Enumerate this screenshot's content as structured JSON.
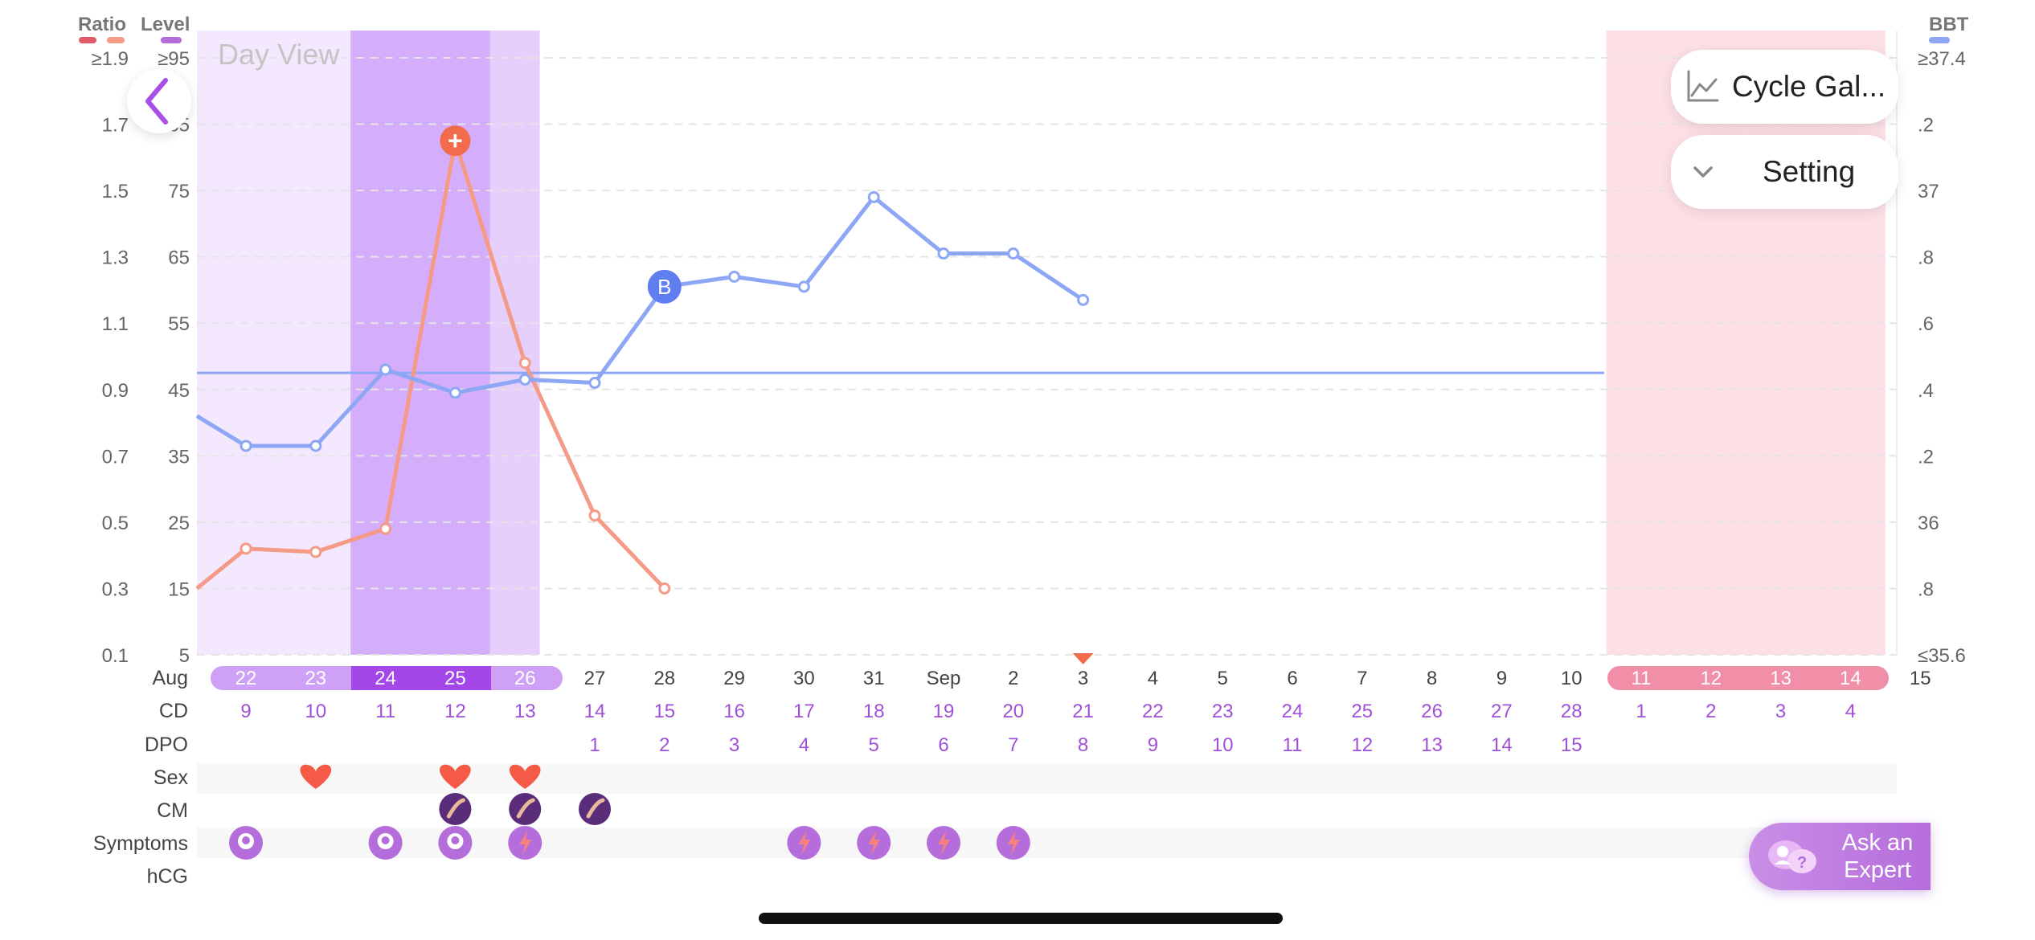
{
  "view_label": "Day View",
  "header": {
    "ratio_label": "Ratio",
    "level_label": "Level",
    "bbt_label": "BBT"
  },
  "axes": {
    "ratio_ticks": [
      "≥1.9",
      "1.7",
      "1.5",
      "1.3",
      "1.1",
      "0.9",
      "0.7",
      "0.5",
      "0.3",
      "0.1"
    ],
    "level_ticks": [
      "≥95",
      "85",
      "75",
      "65",
      "55",
      "45",
      "35",
      "25",
      "15",
      "5"
    ],
    "bbt_ticks": [
      "≥37.4",
      ".2",
      "37",
      ".8",
      ".6",
      ".4",
      ".2",
      "36",
      ".8",
      "≤35.6"
    ]
  },
  "buttons": {
    "cycle_label": "Cycle Gal...",
    "setting_label": "Setting",
    "ask_line1": "Ask an",
    "ask_line2": "Expert"
  },
  "rows": {
    "date_label": "Aug",
    "cd_label": "CD",
    "dpo_label": "DPO",
    "sex_label": "Sex",
    "cm_label": "CM",
    "symptoms_label": "Symptoms",
    "hcg_label": "hCG"
  },
  "days": [
    {
      "date": "22",
      "cd": "9",
      "dpo": "",
      "sex": false,
      "cm": false,
      "symptom": "ovary",
      "band": "light"
    },
    {
      "date": "23",
      "cd": "10",
      "dpo": "",
      "sex": true,
      "cm": false,
      "symptom": "",
      "band": "light"
    },
    {
      "date": "24",
      "cd": "11",
      "dpo": "",
      "sex": false,
      "cm": false,
      "symptom": "ovary",
      "band": "peak"
    },
    {
      "date": "25",
      "cd": "12",
      "dpo": "",
      "sex": true,
      "cm": true,
      "symptom": "ovary",
      "band": "peak"
    },
    {
      "date": "26",
      "cd": "13",
      "dpo": "",
      "sex": true,
      "cm": true,
      "symptom": "bolt",
      "band": "medium"
    },
    {
      "date": "27",
      "cd": "14",
      "dpo": "1",
      "sex": false,
      "cm": true,
      "symptom": "",
      "band": ""
    },
    {
      "date": "28",
      "cd": "15",
      "dpo": "2",
      "sex": false,
      "cm": false,
      "symptom": "",
      "band": ""
    },
    {
      "date": "29",
      "cd": "16",
      "dpo": "3",
      "sex": false,
      "cm": false,
      "symptom": "",
      "band": ""
    },
    {
      "date": "30",
      "cd": "17",
      "dpo": "4",
      "sex": false,
      "cm": false,
      "symptom": "bolt",
      "band": ""
    },
    {
      "date": "31",
      "cd": "18",
      "dpo": "5",
      "sex": false,
      "cm": false,
      "symptom": "bolt",
      "band": ""
    },
    {
      "date": "Sep",
      "cd": "19",
      "dpo": "6",
      "sex": false,
      "cm": false,
      "symptom": "bolt",
      "band": ""
    },
    {
      "date": "2",
      "cd": "20",
      "dpo": "7",
      "sex": false,
      "cm": false,
      "symptom": "bolt",
      "band": ""
    },
    {
      "date": "3",
      "cd": "21",
      "dpo": "8",
      "sex": false,
      "cm": false,
      "symptom": "",
      "band": "",
      "today": true
    },
    {
      "date": "4",
      "cd": "22",
      "dpo": "9",
      "sex": false,
      "cm": false,
      "symptom": "",
      "band": ""
    },
    {
      "date": "5",
      "cd": "23",
      "dpo": "10",
      "sex": false,
      "cm": false,
      "symptom": "",
      "band": ""
    },
    {
      "date": "6",
      "cd": "24",
      "dpo": "11",
      "sex": false,
      "cm": false,
      "symptom": "",
      "band": ""
    },
    {
      "date": "7",
      "cd": "25",
      "dpo": "12",
      "sex": false,
      "cm": false,
      "symptom": "",
      "band": ""
    },
    {
      "date": "8",
      "cd": "26",
      "dpo": "13",
      "sex": false,
      "cm": false,
      "symptom": "",
      "band": ""
    },
    {
      "date": "9",
      "cd": "27",
      "dpo": "14",
      "sex": false,
      "cm": false,
      "symptom": "",
      "band": ""
    },
    {
      "date": "10",
      "cd": "28",
      "dpo": "15",
      "sex": false,
      "cm": false,
      "symptom": "",
      "band": ""
    },
    {
      "date": "11",
      "cd": "1",
      "dpo": "",
      "sex": false,
      "cm": false,
      "symptom": "",
      "band": "period"
    },
    {
      "date": "12",
      "cd": "2",
      "dpo": "",
      "sex": false,
      "cm": false,
      "symptom": "",
      "band": "period"
    },
    {
      "date": "13",
      "cd": "3",
      "dpo": "",
      "sex": false,
      "cm": false,
      "symptom": "",
      "band": "period"
    },
    {
      "date": "14",
      "cd": "4",
      "dpo": "",
      "sex": false,
      "cm": false,
      "symptom": "",
      "band": "period"
    },
    {
      "date": "15",
      "cd": "",
      "dpo": "",
      "sex": false,
      "cm": false,
      "symptom": "",
      "band": ""
    }
  ],
  "chart_data": {
    "type": "line",
    "x_categories": [
      "Aug 22",
      "23",
      "24",
      "25",
      "26",
      "27",
      "28",
      "29",
      "30",
      "31",
      "Sep",
      "2",
      "3",
      "4",
      "5",
      "6",
      "7",
      "8",
      "9",
      "10",
      "11",
      "12",
      "13",
      "14",
      "15"
    ],
    "series": [
      {
        "values": [
          0.42,
          0.41,
          0.48,
          1.65,
          0.98,
          0.52,
          0.3,
          null,
          null,
          null,
          null,
          null,
          null,
          null,
          null,
          null,
          null,
          null,
          null,
          null,
          null,
          null,
          null,
          null,
          null
        ],
        "leading_value": 0.3,
        "peak_marker": "+",
        "axis": "ratio",
        "color": "#f59a86",
        "axis_range": [
          0.1,
          1.9
        ]
      },
      {
        "values": [
          36.23,
          36.23,
          36.46,
          36.39,
          36.43,
          36.42,
          36.71,
          36.74,
          36.71,
          36.98,
          36.81,
          36.81,
          36.67,
          null,
          null,
          null,
          null,
          null,
          null,
          null,
          null,
          null,
          null,
          null,
          null
        ],
        "leading_value": 36.32,
        "coverline": 36.45,
        "marker_label": "B",
        "axis": "bbt",
        "color": "#8ea7f5",
        "axis_range": [
          35.6,
          37.4
        ]
      }
    ],
    "accent_colors": {
      "peak_band": "#d5aefb",
      "high_band": "#e6cffb",
      "light_band": "#f3e8fd",
      "period_band": "#fde0e6",
      "pink_line": "#f59a86",
      "blue_line": "#8ea7f5",
      "pill_purple": "#b56ddc"
    }
  }
}
